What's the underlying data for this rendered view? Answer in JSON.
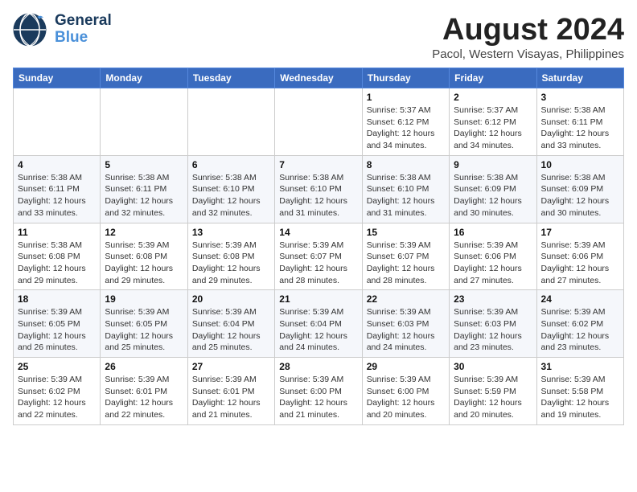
{
  "logo": {
    "general": "General",
    "blue": "Blue"
  },
  "title": "August 2024",
  "subtitle": "Pacol, Western Visayas, Philippines",
  "days_of_week": [
    "Sunday",
    "Monday",
    "Tuesday",
    "Wednesday",
    "Thursday",
    "Friday",
    "Saturday"
  ],
  "weeks": [
    [
      {
        "day": "",
        "info": ""
      },
      {
        "day": "",
        "info": ""
      },
      {
        "day": "",
        "info": ""
      },
      {
        "day": "",
        "info": ""
      },
      {
        "day": "1",
        "info": "Sunrise: 5:37 AM\nSunset: 6:12 PM\nDaylight: 12 hours\nand 34 minutes."
      },
      {
        "day": "2",
        "info": "Sunrise: 5:37 AM\nSunset: 6:12 PM\nDaylight: 12 hours\nand 34 minutes."
      },
      {
        "day": "3",
        "info": "Sunrise: 5:38 AM\nSunset: 6:11 PM\nDaylight: 12 hours\nand 33 minutes."
      }
    ],
    [
      {
        "day": "4",
        "info": "Sunrise: 5:38 AM\nSunset: 6:11 PM\nDaylight: 12 hours\nand 33 minutes."
      },
      {
        "day": "5",
        "info": "Sunrise: 5:38 AM\nSunset: 6:11 PM\nDaylight: 12 hours\nand 32 minutes."
      },
      {
        "day": "6",
        "info": "Sunrise: 5:38 AM\nSunset: 6:10 PM\nDaylight: 12 hours\nand 32 minutes."
      },
      {
        "day": "7",
        "info": "Sunrise: 5:38 AM\nSunset: 6:10 PM\nDaylight: 12 hours\nand 31 minutes."
      },
      {
        "day": "8",
        "info": "Sunrise: 5:38 AM\nSunset: 6:10 PM\nDaylight: 12 hours\nand 31 minutes."
      },
      {
        "day": "9",
        "info": "Sunrise: 5:38 AM\nSunset: 6:09 PM\nDaylight: 12 hours\nand 30 minutes."
      },
      {
        "day": "10",
        "info": "Sunrise: 5:38 AM\nSunset: 6:09 PM\nDaylight: 12 hours\nand 30 minutes."
      }
    ],
    [
      {
        "day": "11",
        "info": "Sunrise: 5:38 AM\nSunset: 6:08 PM\nDaylight: 12 hours\nand 29 minutes."
      },
      {
        "day": "12",
        "info": "Sunrise: 5:39 AM\nSunset: 6:08 PM\nDaylight: 12 hours\nand 29 minutes."
      },
      {
        "day": "13",
        "info": "Sunrise: 5:39 AM\nSunset: 6:08 PM\nDaylight: 12 hours\nand 29 minutes."
      },
      {
        "day": "14",
        "info": "Sunrise: 5:39 AM\nSunset: 6:07 PM\nDaylight: 12 hours\nand 28 minutes."
      },
      {
        "day": "15",
        "info": "Sunrise: 5:39 AM\nSunset: 6:07 PM\nDaylight: 12 hours\nand 28 minutes."
      },
      {
        "day": "16",
        "info": "Sunrise: 5:39 AM\nSunset: 6:06 PM\nDaylight: 12 hours\nand 27 minutes."
      },
      {
        "day": "17",
        "info": "Sunrise: 5:39 AM\nSunset: 6:06 PM\nDaylight: 12 hours\nand 27 minutes."
      }
    ],
    [
      {
        "day": "18",
        "info": "Sunrise: 5:39 AM\nSunset: 6:05 PM\nDaylight: 12 hours\nand 26 minutes."
      },
      {
        "day": "19",
        "info": "Sunrise: 5:39 AM\nSunset: 6:05 PM\nDaylight: 12 hours\nand 25 minutes."
      },
      {
        "day": "20",
        "info": "Sunrise: 5:39 AM\nSunset: 6:04 PM\nDaylight: 12 hours\nand 25 minutes."
      },
      {
        "day": "21",
        "info": "Sunrise: 5:39 AM\nSunset: 6:04 PM\nDaylight: 12 hours\nand 24 minutes."
      },
      {
        "day": "22",
        "info": "Sunrise: 5:39 AM\nSunset: 6:03 PM\nDaylight: 12 hours\nand 24 minutes."
      },
      {
        "day": "23",
        "info": "Sunrise: 5:39 AM\nSunset: 6:03 PM\nDaylight: 12 hours\nand 23 minutes."
      },
      {
        "day": "24",
        "info": "Sunrise: 5:39 AM\nSunset: 6:02 PM\nDaylight: 12 hours\nand 23 minutes."
      }
    ],
    [
      {
        "day": "25",
        "info": "Sunrise: 5:39 AM\nSunset: 6:02 PM\nDaylight: 12 hours\nand 22 minutes."
      },
      {
        "day": "26",
        "info": "Sunrise: 5:39 AM\nSunset: 6:01 PM\nDaylight: 12 hours\nand 22 minutes."
      },
      {
        "day": "27",
        "info": "Sunrise: 5:39 AM\nSunset: 6:01 PM\nDaylight: 12 hours\nand 21 minutes."
      },
      {
        "day": "28",
        "info": "Sunrise: 5:39 AM\nSunset: 6:00 PM\nDaylight: 12 hours\nand 21 minutes."
      },
      {
        "day": "29",
        "info": "Sunrise: 5:39 AM\nSunset: 6:00 PM\nDaylight: 12 hours\nand 20 minutes."
      },
      {
        "day": "30",
        "info": "Sunrise: 5:39 AM\nSunset: 5:59 PM\nDaylight: 12 hours\nand 20 minutes."
      },
      {
        "day": "31",
        "info": "Sunrise: 5:39 AM\nSunset: 5:58 PM\nDaylight: 12 hours\nand 19 minutes."
      }
    ]
  ]
}
